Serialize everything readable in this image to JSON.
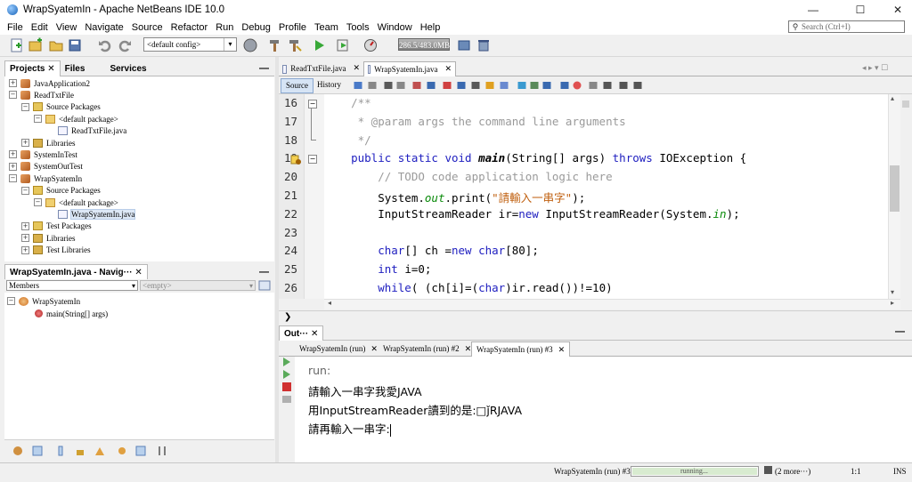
{
  "window": {
    "title": "WrapSyatemIn - Apache NetBeans IDE 10.0"
  },
  "menu": [
    "File",
    "Edit",
    "View",
    "Navigate",
    "Source",
    "Refactor",
    "Run",
    "Debug",
    "Profile",
    "Team",
    "Tools",
    "Window",
    "Help"
  ],
  "search": {
    "placeholder": "Search (Ctrl+I)"
  },
  "toolbar": {
    "config": "<default config>",
    "memory": "286.5/483.0MB"
  },
  "projects": {
    "tabs": [
      "Projects",
      "Files",
      "Services"
    ],
    "tree": [
      {
        "label": "JavaApplication2",
        "icon": "proj",
        "exp": "+",
        "indent": 0
      },
      {
        "label": "ReadTxtFile",
        "icon": "proj",
        "exp": "−",
        "indent": 0
      },
      {
        "label": "Source Packages",
        "icon": "pkgf",
        "exp": "−",
        "indent": 1
      },
      {
        "label": "<default package>",
        "icon": "pkg",
        "exp": "−",
        "indent": 2
      },
      {
        "label": "ReadTxtFile.java",
        "icon": "jfile",
        "exp": "",
        "indent": 3
      },
      {
        "label": "Libraries",
        "icon": "lib",
        "exp": "+",
        "indent": 1
      },
      {
        "label": "SystemInTest",
        "icon": "proj",
        "exp": "+",
        "indent": 0
      },
      {
        "label": "SystemOutTest",
        "icon": "proj",
        "exp": "+",
        "indent": 0
      },
      {
        "label": "WrapSyatemIn",
        "icon": "proj",
        "exp": "−",
        "indent": 0
      },
      {
        "label": "Source Packages",
        "icon": "pkgf",
        "exp": "−",
        "indent": 1
      },
      {
        "label": "<default package>",
        "icon": "pkg",
        "exp": "−",
        "indent": 2
      },
      {
        "label": "WrapSyatemIn.java",
        "icon": "jfile",
        "exp": "",
        "indent": 3,
        "selected": true
      },
      {
        "label": "Test Packages",
        "icon": "pkgf",
        "exp": "+",
        "indent": 1
      },
      {
        "label": "Libraries",
        "icon": "lib",
        "exp": "+",
        "indent": 1
      },
      {
        "label": "Test Libraries",
        "icon": "lib",
        "exp": "+",
        "indent": 1
      }
    ]
  },
  "navigator": {
    "title": "WrapSyatemIn.java - Navig···",
    "members": "Members",
    "empty": "<empty>",
    "cls": "WrapSyatemIn",
    "method": "main(String[] args)"
  },
  "editor": {
    "tabs": [
      "ReadTxtFile.java",
      "WrapSyatemIn.java"
    ],
    "source": "Source",
    "history": "History",
    "lines": [
      {
        "n": "16",
        "t": "    /**",
        "c": "com"
      },
      {
        "n": "17",
        "t": "     * @param args the command line arguments",
        "c": "com"
      },
      {
        "n": "18",
        "t": "     */",
        "c": "com"
      },
      {
        "n": "19",
        "t": "",
        "c": "main"
      },
      {
        "n": "20",
        "t": "        // TODO code application logic here",
        "c": "com"
      },
      {
        "n": "21",
        "t": "",
        "c": "print"
      },
      {
        "n": "22",
        "t": "",
        "c": "isr"
      },
      {
        "n": "23",
        "t": "",
        "c": "blank"
      },
      {
        "n": "24",
        "t": "",
        "c": "char"
      },
      {
        "n": "25",
        "t": "",
        "c": "int"
      },
      {
        "n": "26",
        "t": "",
        "c": "while"
      }
    ],
    "print_str": "\"請輸入一串字\""
  },
  "output": {
    "title": "Out···",
    "tabs": [
      "WrapSyatemIn (run)",
      "WrapSyatemIn (run) #2",
      "WrapSyatemIn (run) #3"
    ],
    "lines": [
      "run:",
      "請輸入一串字我愛JAVA",
      "用InputStreamReader讀到的是:□ǰRJAVA",
      "請再輸入一串字:"
    ]
  },
  "status": {
    "task": "WrapSyatemIn (run) #3",
    "progress": "running...",
    "more": "(2 more···)",
    "pos": "1:1",
    "mode": "INS"
  }
}
